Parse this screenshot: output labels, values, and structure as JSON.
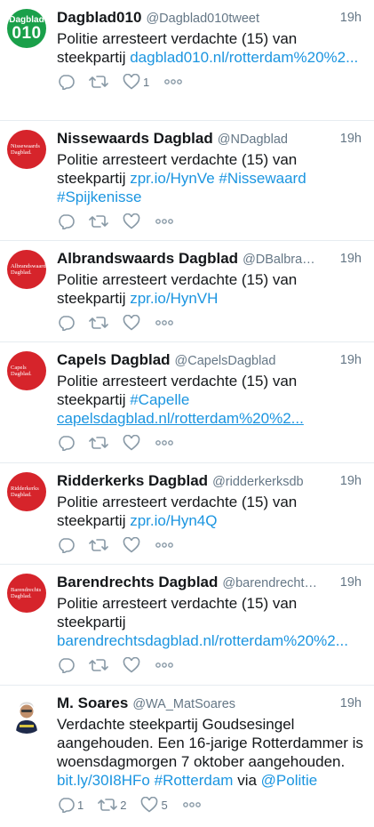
{
  "tweets": [
    {
      "name": "Dagblad010",
      "handle": "@Dagblad010tweet",
      "time": "19h",
      "avatar": {
        "style": "green",
        "top": "Dagblad",
        "big": "010"
      },
      "text": "Politie arresteert verdachte (15) van steekpartij",
      "links": [
        "dagblad010.nl/rotterdam%20%2..."
      ],
      "like_count": "1"
    },
    {
      "name": "Nissewaards Dagblad",
      "handle": "@NDagblad",
      "time": "19h",
      "avatar": {
        "style": "red",
        "logo": "Nissewaards Dagblad."
      },
      "text": "Politie arresteert verdachte (15) van steekpartij",
      "links": [
        "zpr.io/HynVe",
        "#Nissewaard",
        "#Spijkenisse"
      ]
    },
    {
      "name": "Albrandswaards Dagblad",
      "handle": "@DBalbrand...",
      "time": "19h",
      "avatar": {
        "style": "red",
        "logo": "Albrandswaards Dagblad."
      },
      "text": "Politie arresteert verdachte (15) van steekpartij",
      "links": [
        "zpr.io/HynVH"
      ]
    },
    {
      "name": "Capels Dagblad",
      "handle": "@CapelsDagblad",
      "time": "19h",
      "avatar": {
        "style": "red",
        "logo": "Capels Dagblad."
      },
      "text": "Politie arresteert verdachte (15) van steekpartij",
      "links": [
        "#Capelle",
        "capelsdagblad.nl/rotterdam%20%2..."
      ]
    },
    {
      "name": "Ridderkerks Dagblad",
      "handle": "@ridderkerksdb",
      "time": "19h",
      "avatar": {
        "style": "red",
        "logo": "Ridderkerks Dagblad."
      },
      "text": "Politie arresteert verdachte (15) van steekpartij",
      "links": [
        "zpr.io/Hyn4Q"
      ]
    },
    {
      "name": "Barendrechts Dagblad",
      "handle": "@barendrechtsdb",
      "time": "19h",
      "avatar": {
        "style": "red",
        "logo": "Barendrechts Dagblad."
      },
      "text": "Politie arresteert verdachte (15) van steekpartij",
      "links": [
        "barendrechtsdagblad.nl/rotterdam%20%2..."
      ]
    },
    {
      "name": "M. Soares",
      "handle": "@WA_MatSoares",
      "time": "19h",
      "avatar": {
        "style": "photo"
      },
      "text": "Verdachte steekpartij Goudsesingel aangehouden. Een 16-jarige Rotterdammer is woensdagmorgen 7 oktober aangehouden.",
      "links": [
        "bit.ly/30I8HFo",
        "#Rotterdam"
      ],
      "via": "via",
      "via_link": "@Politie",
      "reply_count": "1",
      "retweet_count": "2",
      "like_count": "5"
    }
  ],
  "icons": {
    "reply": "reply-icon",
    "retweet": "retweet-icon",
    "like": "heart-icon",
    "more": "more-icon"
  },
  "colors": {
    "link": "#1b95e0",
    "secondary": "#657786",
    "divider": "#e6ecf0",
    "red_avatar": "#d6242b",
    "green_avatar": "#1aa04a"
  }
}
